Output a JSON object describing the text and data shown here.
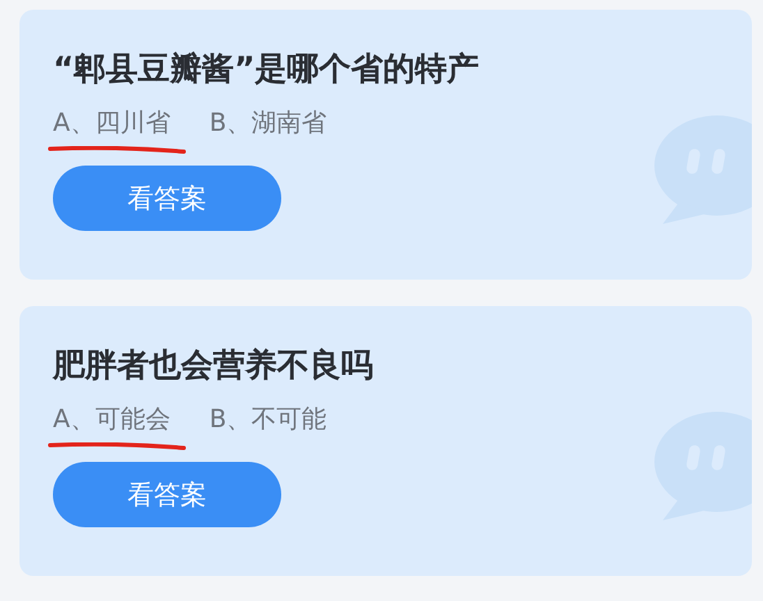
{
  "cards": [
    {
      "question": "“郫县豆瓣酱”是哪个省的特产",
      "options": [
        {
          "text": "A、四川省",
          "marked": true
        },
        {
          "text": "B、湖南省",
          "marked": false
        }
      ],
      "button": "看答案"
    },
    {
      "question": "肥胖者也会营养不良吗",
      "options": [
        {
          "text": "A、可能会",
          "marked": true
        },
        {
          "text": "B、不可能",
          "marked": false
        }
      ],
      "button": "看答案"
    }
  ]
}
